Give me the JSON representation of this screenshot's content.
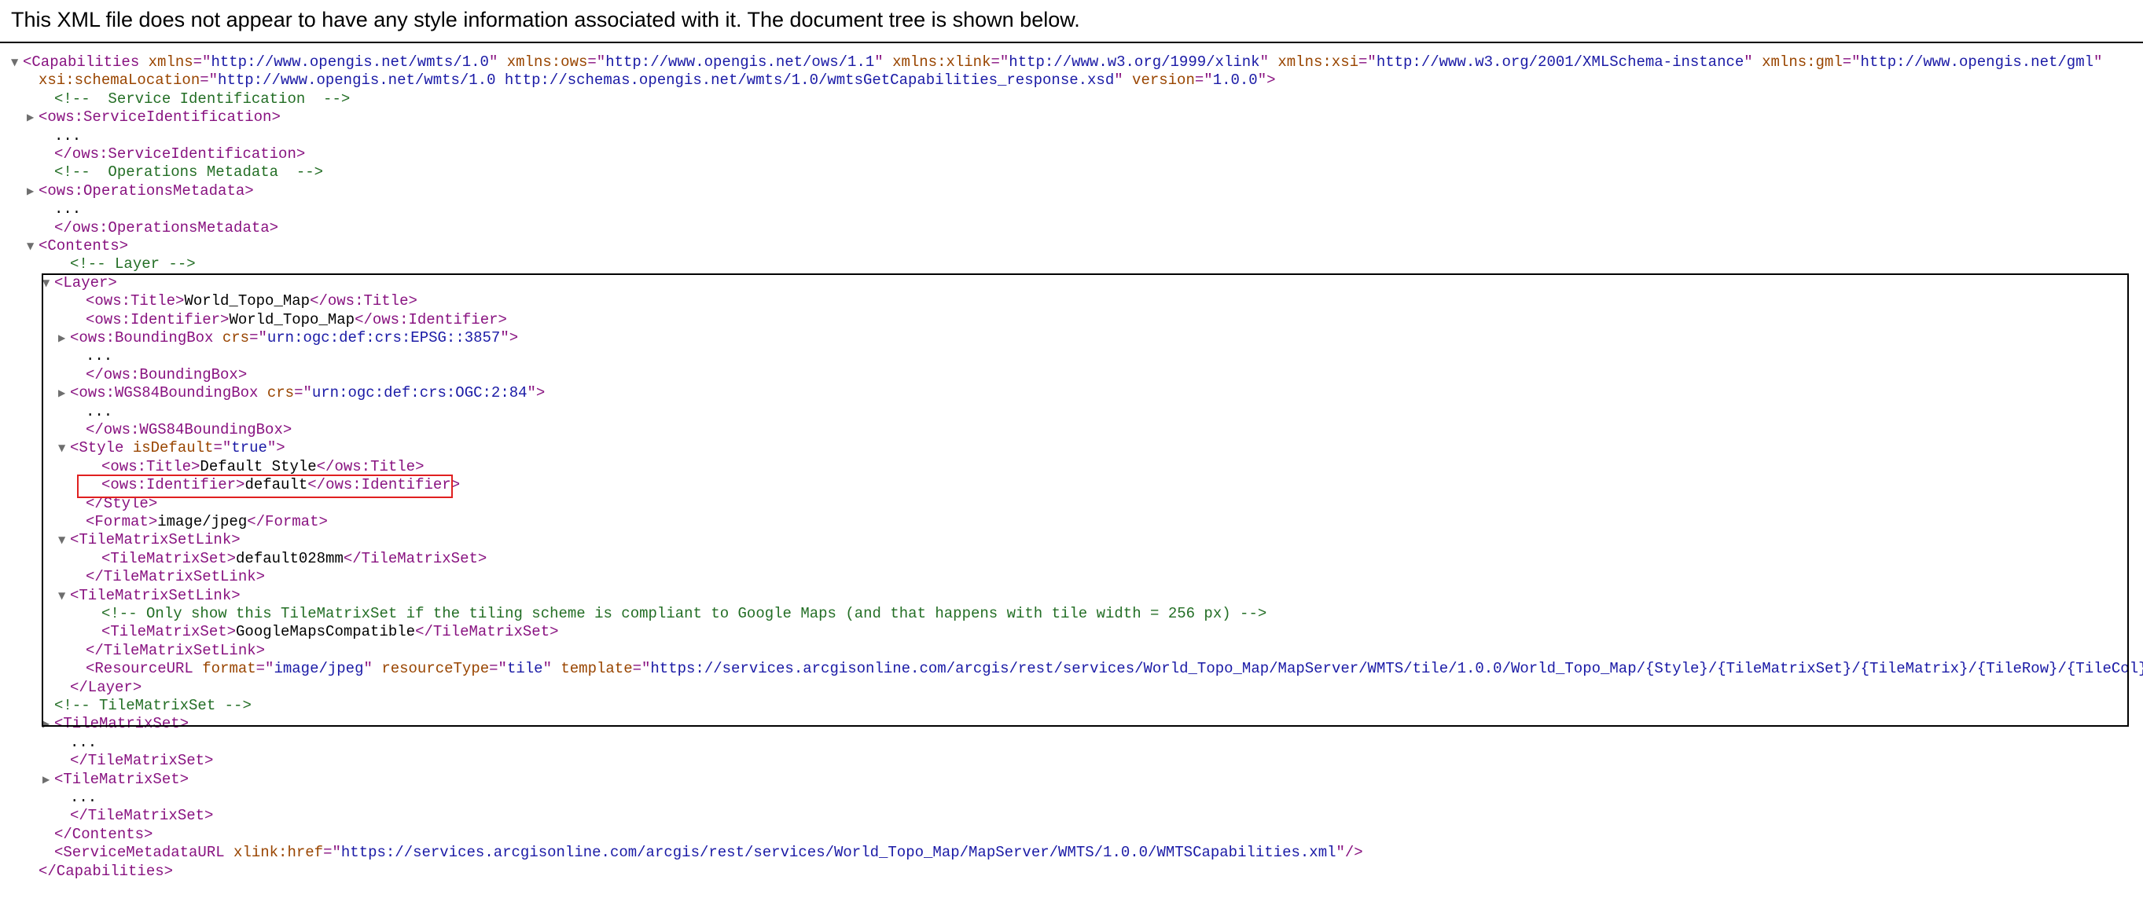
{
  "header": {
    "message": "This XML file does not appear to have any style information associated with it. The document tree is shown below."
  },
  "tree": {
    "lines": [
      {
        "toggle": "▼",
        "segments": [
          {
            "c": "t",
            "s": "<Capabilities "
          },
          {
            "c": "an",
            "s": "xmlns"
          },
          {
            "c": "t",
            "s": "=\""
          },
          {
            "c": "av",
            "s": "http://www.opengis.net/wmts/1.0"
          },
          {
            "c": "t",
            "s": "\" "
          },
          {
            "c": "an",
            "s": "xmlns:ows"
          },
          {
            "c": "t",
            "s": "=\""
          },
          {
            "c": "av",
            "s": "http://www.opengis.net/ows/1.1"
          },
          {
            "c": "t",
            "s": "\" "
          },
          {
            "c": "an",
            "s": "xmlns:xlink"
          },
          {
            "c": "t",
            "s": "=\""
          },
          {
            "c": "av",
            "s": "http://www.w3.org/1999/xlink"
          },
          {
            "c": "t",
            "s": "\" "
          },
          {
            "c": "an",
            "s": "xmlns:xsi"
          },
          {
            "c": "t",
            "s": "=\""
          },
          {
            "c": "av",
            "s": "http://www.w3.org/2001/XMLSchema-instance"
          },
          {
            "c": "t",
            "s": "\" "
          },
          {
            "c": "an",
            "s": "xmlns:gml"
          },
          {
            "c": "t",
            "s": "=\""
          },
          {
            "c": "av",
            "s": "http://www.opengis.net/gml"
          },
          {
            "c": "t",
            "s": "\""
          }
        ]
      },
      {
        "segments": [
          {
            "c": "an",
            "s": "xsi:schemaLocation"
          },
          {
            "c": "t",
            "s": "=\""
          },
          {
            "c": "av",
            "s": "http://www.opengis.net/wmts/1.0 http://schemas.opengis.net/wmts/1.0/wmtsGetCapabilities_response.xsd"
          },
          {
            "c": "t",
            "s": "\" "
          },
          {
            "c": "an",
            "s": "version"
          },
          {
            "c": "t",
            "s": "=\""
          },
          {
            "c": "av",
            "s": "1.0.0"
          },
          {
            "c": "t",
            "s": "\">"
          }
        ]
      },
      {
        "segments": [
          {
            "c": "cm",
            "s": "<!--  Service Identification  -->"
          }
        ]
      },
      {
        "toggle": "▶",
        "segments": [
          {
            "c": "t",
            "s": "<ows:ServiceIdentification>"
          }
        ]
      },
      {
        "segments": [
          {
            "c": "tx",
            "s": "..."
          }
        ]
      },
      {
        "segments": [
          {
            "c": "t",
            "s": "</ows:ServiceIdentification>"
          }
        ]
      },
      {
        "segments": [
          {
            "c": "cm",
            "s": "<!--  Operations Metadata  -->"
          }
        ]
      },
      {
        "toggle": "▶",
        "segments": [
          {
            "c": "t",
            "s": "<ows:OperationsMetadata>"
          }
        ]
      },
      {
        "segments": [
          {
            "c": "tx",
            "s": "..."
          }
        ]
      },
      {
        "segments": [
          {
            "c": "t",
            "s": "</ows:OperationsMetadata>"
          }
        ]
      },
      {
        "toggle": "▼",
        "segments": [
          {
            "c": "t",
            "s": "<Contents>"
          }
        ]
      },
      {
        "segments": [
          {
            "c": "cm",
            "s": "<!-- Layer -->"
          }
        ]
      },
      {
        "toggle": "▼",
        "segments": [
          {
            "c": "t",
            "s": "<Layer>"
          }
        ]
      },
      {
        "segments": [
          {
            "c": "t",
            "s": "<ows:Title>"
          },
          {
            "c": "tx",
            "s": "World_Topo_Map"
          },
          {
            "c": "t",
            "s": "</ows:Title>"
          }
        ]
      },
      {
        "segments": [
          {
            "c": "t",
            "s": "<ows:Identifier>"
          },
          {
            "c": "tx",
            "s": "World_Topo_Map"
          },
          {
            "c": "t",
            "s": "</ows:Identifier>"
          }
        ]
      },
      {
        "toggle": "▶",
        "segments": [
          {
            "c": "t",
            "s": "<ows:BoundingBox "
          },
          {
            "c": "an",
            "s": "crs"
          },
          {
            "c": "t",
            "s": "=\""
          },
          {
            "c": "av",
            "s": "urn:ogc:def:crs:EPSG::3857"
          },
          {
            "c": "t",
            "s": "\">"
          }
        ]
      },
      {
        "segments": [
          {
            "c": "tx",
            "s": "..."
          }
        ]
      },
      {
        "segments": [
          {
            "c": "t",
            "s": "</ows:BoundingBox>"
          }
        ]
      },
      {
        "toggle": "▶",
        "segments": [
          {
            "c": "t",
            "s": "<ows:WGS84BoundingBox "
          },
          {
            "c": "an",
            "s": "crs"
          },
          {
            "c": "t",
            "s": "=\""
          },
          {
            "c": "av",
            "s": "urn:ogc:def:crs:OGC:2:84"
          },
          {
            "c": "t",
            "s": "\">"
          }
        ]
      },
      {
        "segments": [
          {
            "c": "tx",
            "s": "..."
          }
        ]
      },
      {
        "segments": [
          {
            "c": "t",
            "s": "</ows:WGS84BoundingBox>"
          }
        ]
      },
      {
        "toggle": "▼",
        "segments": [
          {
            "c": "t",
            "s": "<Style "
          },
          {
            "c": "an",
            "s": "isDefault"
          },
          {
            "c": "t",
            "s": "=\""
          },
          {
            "c": "av",
            "s": "true"
          },
          {
            "c": "t",
            "s": "\">"
          }
        ]
      },
      {
        "segments": [
          {
            "c": "t",
            "s": "<ows:Title>"
          },
          {
            "c": "tx",
            "s": "Default Style"
          },
          {
            "c": "t",
            "s": "</ows:Title>"
          }
        ]
      },
      {
        "segments": [
          {
            "c": "t",
            "s": "<ows:Identifier>"
          },
          {
            "c": "tx",
            "s": "default"
          },
          {
            "c": "t",
            "s": "</ows:Identifier>"
          }
        ]
      },
      {
        "segments": [
          {
            "c": "t",
            "s": "</Style>"
          }
        ]
      },
      {
        "segments": [
          {
            "c": "t",
            "s": "<Format>"
          },
          {
            "c": "tx",
            "s": "image/jpeg"
          },
          {
            "c": "t",
            "s": "</Format>"
          }
        ]
      },
      {
        "toggle": "▼",
        "segments": [
          {
            "c": "t",
            "s": "<TileMatrixSetLink>"
          }
        ]
      },
      {
        "segments": [
          {
            "c": "t",
            "s": "<TileMatrixSet>"
          },
          {
            "c": "tx",
            "s": "default028mm"
          },
          {
            "c": "t",
            "s": "</TileMatrixSet>"
          }
        ]
      },
      {
        "segments": [
          {
            "c": "t",
            "s": "</TileMatrixSetLink>"
          }
        ]
      },
      {
        "toggle": "▼",
        "segments": [
          {
            "c": "t",
            "s": "<TileMatrixSetLink>"
          }
        ]
      },
      {
        "segments": [
          {
            "c": "cm",
            "s": "<!-- Only show this TileMatrixSet if the tiling scheme is compliant to Google Maps (and that happens with tile width = 256 px) -->"
          }
        ]
      },
      {
        "segments": [
          {
            "c": "t",
            "s": "<TileMatrixSet>"
          },
          {
            "c": "tx",
            "s": "GoogleMapsCompatible"
          },
          {
            "c": "t",
            "s": "</TileMatrixSet>"
          }
        ]
      },
      {
        "segments": [
          {
            "c": "t",
            "s": "</TileMatrixSetLink>"
          }
        ]
      },
      {
        "segments": [
          {
            "c": "t",
            "s": "<ResourceURL "
          },
          {
            "c": "an",
            "s": "format"
          },
          {
            "c": "t",
            "s": "=\""
          },
          {
            "c": "av",
            "s": "image/jpeg"
          },
          {
            "c": "t",
            "s": "\" "
          },
          {
            "c": "an",
            "s": "resourceType"
          },
          {
            "c": "t",
            "s": "=\""
          },
          {
            "c": "av",
            "s": "tile"
          },
          {
            "c": "t",
            "s": "\" "
          },
          {
            "c": "an",
            "s": "template"
          },
          {
            "c": "t",
            "s": "=\""
          },
          {
            "c": "av",
            "s": "https://services.arcgisonline.com/arcgis/rest/services/World_Topo_Map/MapServer/WMTS/tile/1.0.0/World_Topo_Map/{Style}/{TileMatrixSet}/{TileMatrix}/{TileRow}/{TileCol}.jpg"
          },
          {
            "c": "t",
            "s": "\"/>"
          }
        ]
      },
      {
        "segments": [
          {
            "c": "t",
            "s": "</Layer>"
          }
        ]
      },
      {
        "segments": [
          {
            "c": "cm",
            "s": "<!-- TileMatrixSet -->"
          }
        ]
      },
      {
        "toggle": "▶",
        "segments": [
          {
            "c": "t",
            "s": "<TileMatrixSet>"
          }
        ]
      },
      {
        "segments": [
          {
            "c": "tx",
            "s": "..."
          }
        ]
      },
      {
        "segments": [
          {
            "c": "t",
            "s": "</TileMatrixSet>"
          }
        ]
      },
      {
        "toggle": "▶",
        "segments": [
          {
            "c": "t",
            "s": "<TileMatrixSet>"
          }
        ]
      },
      {
        "segments": [
          {
            "c": "tx",
            "s": "..."
          }
        ]
      },
      {
        "segments": [
          {
            "c": "t",
            "s": "</TileMatrixSet>"
          }
        ]
      },
      {
        "segments": [
          {
            "c": "t",
            "s": "</Contents>"
          }
        ]
      },
      {
        "segments": [
          {
            "c": "t",
            "s": "<ServiceMetadataURL "
          },
          {
            "c": "an",
            "s": "xlink:href"
          },
          {
            "c": "t",
            "s": "=\""
          },
          {
            "c": "av",
            "s": "https://services.arcgisonline.com/arcgis/rest/services/World_Topo_Map/MapServer/WMTS/1.0.0/WMTSCapabilities.xml"
          },
          {
            "c": "t",
            "s": "\"/>"
          }
        ]
      },
      {
        "segments": [
          {
            "c": "t",
            "s": "</Capabilities>"
          }
        ]
      }
    ]
  },
  "colors": {
    "tag": "#881280",
    "attr_name": "#994500",
    "attr_value": "#1a1aa6",
    "text": "#000000",
    "comment": "#236e25",
    "layer_box": "#000000",
    "highlight_box": "#e02020"
  }
}
